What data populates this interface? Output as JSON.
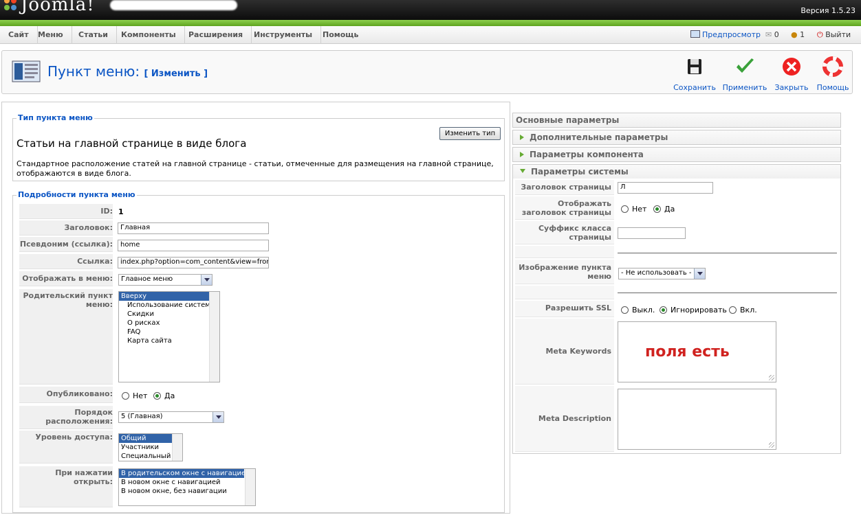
{
  "header": {
    "logo_text": "Joomla!",
    "version": "Версия 1.5.23"
  },
  "menu": {
    "items": [
      "Сайт",
      "Меню",
      "Статьи",
      "Компоненты",
      "Расширения",
      "Инструменты",
      "Помощь"
    ],
    "preview": "Предпросмотр",
    "messages_count": "0",
    "users_count": "1",
    "logout": "Выйти"
  },
  "toolbar": {
    "title": "Пункт меню:",
    "subtitle": "[ Изменить ]",
    "save": "Сохранить",
    "apply": "Применить",
    "close": "Закрыть",
    "help": "Помощь"
  },
  "type_box": {
    "legend": "Тип пункта меню",
    "change_button": "Изменить тип",
    "title": "Статьи на главной странице в виде блога",
    "description": "Стандартное расположение статей на главной странице - статьи, отмеченные для размещения на главной странице, отображаются в виде блога."
  },
  "details": {
    "legend": "Подробности пункта меню",
    "id_label": "ID:",
    "id_value": "1",
    "title_label": "Заголовок:",
    "title_value": "Главная",
    "alias_label": "Псевдоним (ссылка):",
    "alias_value": "home",
    "link_label": "Ссылка:",
    "link_value": "index.php?option=com_content&view=frontpage",
    "display_in_label": "Отображать в меню:",
    "display_in_value": "Главное меню",
    "parent_label": "Родительский пункт меню:",
    "parent_options": [
      "Вверху",
      "Использование систем",
      "Скидки",
      "О рисках",
      "FAQ",
      "Карта сайта"
    ],
    "published_label": "Опубликовано:",
    "published_no": "Нет",
    "published_yes": "Да",
    "order_label": "Порядок расположения:",
    "order_value": "5 (Главная)",
    "access_label": "Уровень доступа:",
    "access_options": [
      "Общий",
      "Участники",
      "Специальный"
    ],
    "onclick_label": "При нажатии открыть:",
    "onclick_options": [
      "В родительском окне с навигацией",
      "В новом окне с навигацией",
      "В новом окне, без навигации"
    ]
  },
  "params": {
    "basic": "Основные параметры",
    "advanced": "Дополнительные параметры",
    "component": "Параметры компонента",
    "system": "Параметры системы",
    "page_title_label": "Заголовок страницы",
    "page_title_value": "Л",
    "show_title_label": "Отображать заголовок страницы",
    "show_no": "Нет",
    "show_yes": "Да",
    "suffix_label": "Суффикс класса страницы",
    "image_label": "Изображение пункта меню",
    "image_value": "- Не использовать -",
    "ssl_label": "Разрешить SSL",
    "ssl_off": "Выкл.",
    "ssl_ignore": "Игнорировать",
    "ssl_on": "Вкл.",
    "meta_keywords_label": "Meta Keywords",
    "meta_keywords_note": "поля есть",
    "meta_description_label": "Meta Description"
  }
}
